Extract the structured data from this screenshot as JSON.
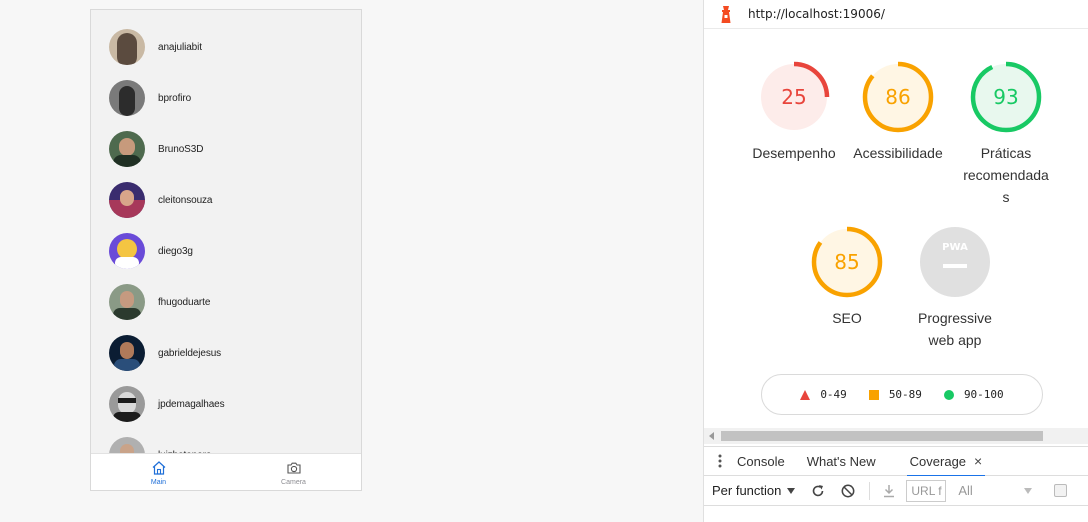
{
  "app": {
    "users": [
      {
        "name": "anajuliabit",
        "avatar_color": "#5b4b3f",
        "avatar_bg": "#c9b9a4"
      },
      {
        "name": "bprofiro",
        "avatar_color": "#2c2c2c",
        "avatar_bg": "#7a7a7a"
      },
      {
        "name": "BrunoS3D",
        "avatar_color": "#203024",
        "avatar_bg": "#4e6a4e"
      },
      {
        "name": "cleitonsouza",
        "avatar_color": "#3a2c6e",
        "avatar_bg": "#a7385a"
      },
      {
        "name": "diego3g",
        "avatar_color": "#6a4bd8",
        "avatar_bg": "#f4c542"
      },
      {
        "name": "fhugoduarte",
        "avatar_color": "#2b3a2e",
        "avatar_bg": "#8a9a86"
      },
      {
        "name": "gabrieldejesus",
        "avatar_color": "#0b1d33",
        "avatar_bg": "#2a4e7a"
      },
      {
        "name": "jpdemagalhaes",
        "avatar_color": "#1b1b1b",
        "avatar_bg": "#9a9a9a"
      },
      {
        "name": "luizbatanero",
        "avatar_color": "#444",
        "avatar_bg": "#b0b0b0"
      }
    ],
    "tabs": [
      {
        "label": "Main",
        "icon": "home-icon",
        "active": true
      },
      {
        "label": "Camera",
        "icon": "camera-icon",
        "active": false
      }
    ]
  },
  "lighthouse": {
    "url": "http://localhost:19006/",
    "scores": [
      {
        "value": "25",
        "label": "Desempenho",
        "color": "#e8453c",
        "bg": "#fdecea",
        "fraction": 0.25
      },
      {
        "value": "86",
        "label": "Acessibilidade",
        "color": "#f9a200",
        "bg": "#fff6e4",
        "fraction": 0.86
      },
      {
        "value": "93",
        "label": "Práticas recomendadas",
        "color": "#18c964",
        "bg": "#e8f8ee",
        "fraction": 0.93
      },
      {
        "value": "85",
        "label": "SEO",
        "color": "#f9a200",
        "bg": "#fff6e4",
        "fraction": 0.85
      }
    ],
    "pwa": {
      "badge": "PWA",
      "label": "Progressive web app"
    },
    "legend": [
      {
        "range": "0-49",
        "shape": "triangle",
        "color": "#e8453c"
      },
      {
        "range": "50-89",
        "shape": "square",
        "color": "#f9a200"
      },
      {
        "range": "90-100",
        "shape": "circle",
        "color": "#18c964"
      }
    ]
  },
  "drawer": {
    "tabs": [
      "Console",
      "What's New",
      "Coverage"
    ],
    "active_tab": "Coverage",
    "close_glyph": "×",
    "toolbar": {
      "select": "Per function",
      "url_placeholder": "URL f",
      "filter": "All"
    }
  }
}
